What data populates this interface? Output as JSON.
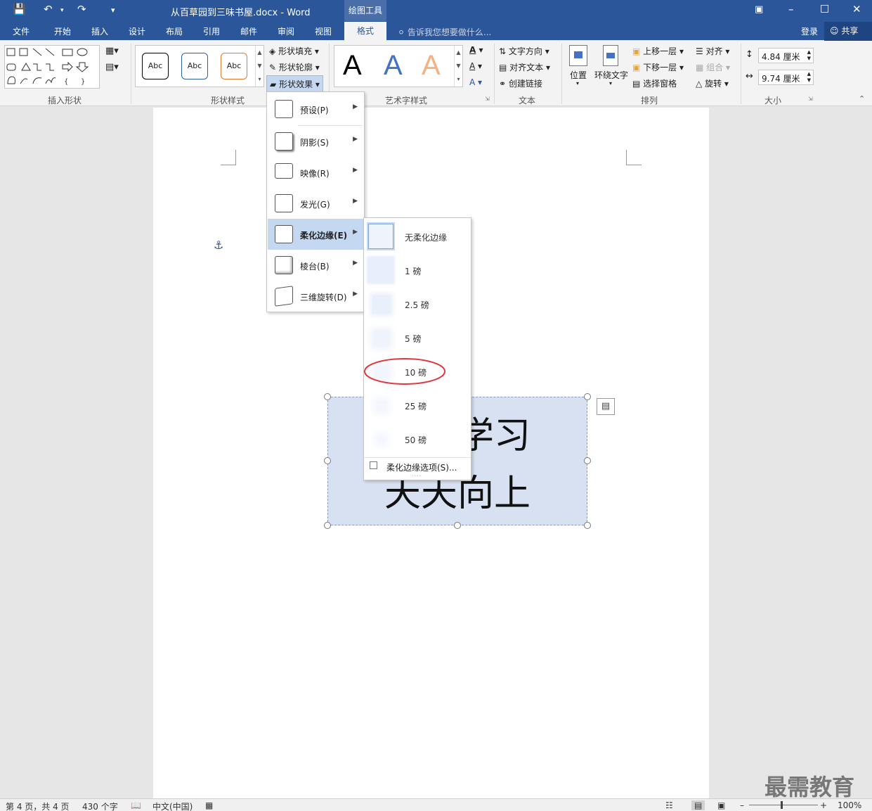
{
  "window": {
    "title": "从百草园到三味书屋.docx - Word",
    "context_tab": "绘图工具"
  },
  "tabs": [
    "文件",
    "开始",
    "插入",
    "设计",
    "布局",
    "引用",
    "邮件",
    "审阅",
    "视图",
    "格式"
  ],
  "tell_me": "告诉我您想要做什么...",
  "login": "登录",
  "share": "共享",
  "ribbon": {
    "groups": {
      "insert_shapes": "插入形状",
      "shape_styles": "形状样式",
      "wordart": "艺术字样式",
      "text": "文本",
      "arrange": "排列",
      "size": "大小"
    },
    "style_samples": [
      "Abc",
      "Abc",
      "Abc"
    ],
    "shape_fill": "形状填充",
    "shape_outline": "形状轮廓",
    "shape_effects": "形状效果",
    "wordart_letter": "A",
    "text_direction": "文字方向",
    "align_text": "对齐文本",
    "create_link": "创建链接",
    "position": "位置",
    "wrap_text": "环绕文字",
    "bring_forward": "上移一层",
    "send_backward": "下移一层",
    "selection_pane": "选择窗格",
    "align": "对齐",
    "group": "组合",
    "rotate": "旋转",
    "height": "4.84 厘米",
    "width": "9.74 厘米"
  },
  "effects_menu": [
    "预设(P)",
    "阴影(S)",
    "映像(R)",
    "发光(G)",
    "柔化边缘(E)",
    "棱台(B)",
    "三维旋转(D)"
  ],
  "soft_edges_menu": {
    "items": [
      "无柔化边缘",
      "1 磅",
      "2.5 磅",
      "5 磅",
      "10 磅",
      "25 磅",
      "50 磅"
    ],
    "options": "柔化边缘选项(S)...",
    "highlight_color": "#e0393e"
  },
  "document": {
    "textbox_lines": [
      "好好学习",
      "天天向上"
    ],
    "anchor_icon": "anchor-icon"
  },
  "status": {
    "page": "第 4 页，共 4 页",
    "words": "430 个字",
    "language": "中文(中国)",
    "zoom": "100%"
  },
  "watermark": "最需教育"
}
